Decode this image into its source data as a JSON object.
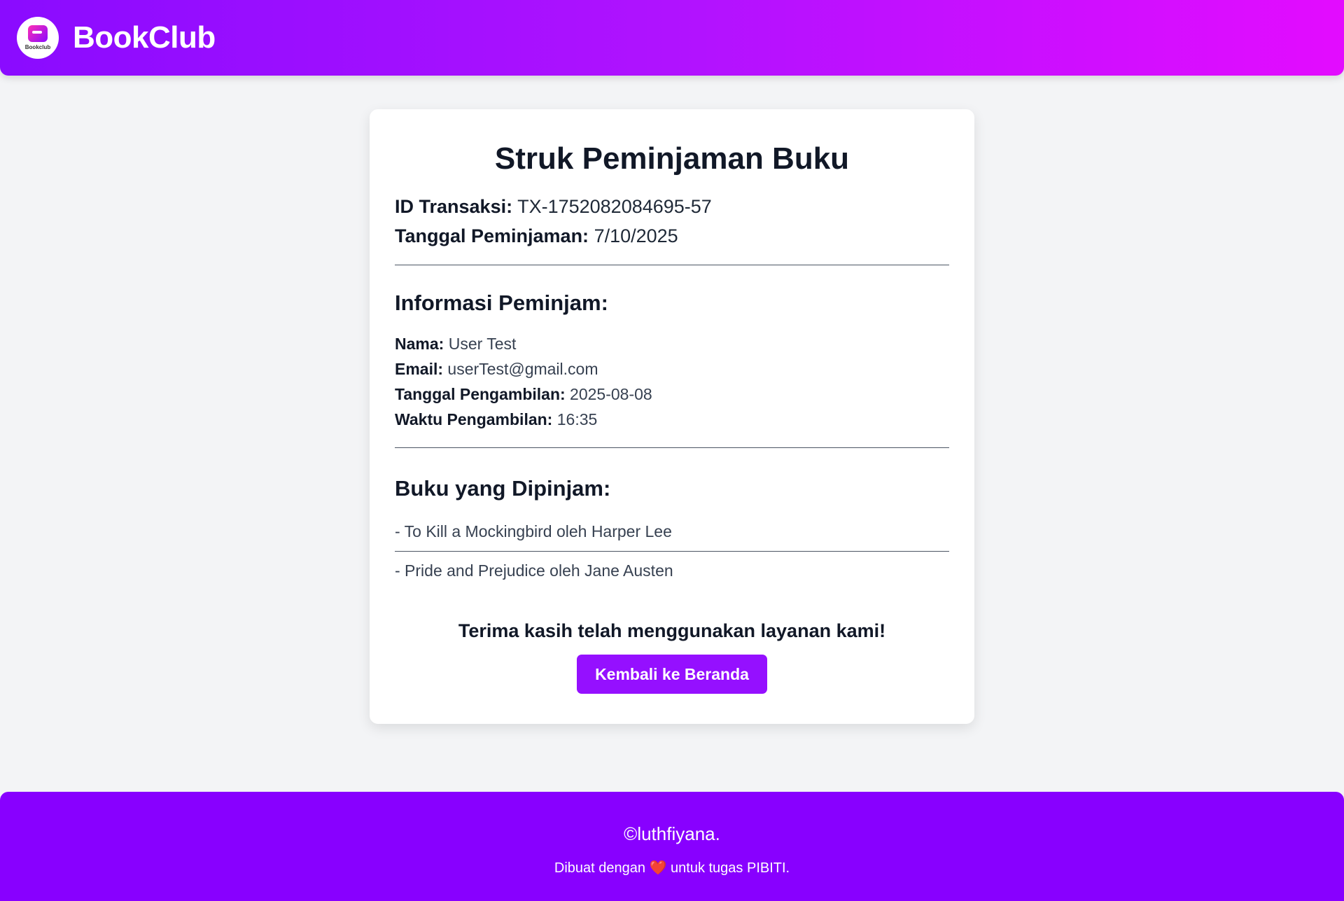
{
  "header": {
    "logo_text": "Bookclub",
    "brand": "BookClub"
  },
  "receipt": {
    "title": "Struk Peminjaman Buku",
    "transaction_id_label": "ID Transaksi:",
    "transaction_id": "TX-1752082084695-57",
    "loan_date_label": "Tanggal Peminjaman:",
    "loan_date": "7/10/2025",
    "borrower": {
      "heading": "Informasi Peminjam:",
      "name_label": "Nama:",
      "name": "User Test",
      "email_label": "Email:",
      "email": "userTest@gmail.com",
      "pickup_date_label": "Tanggal Pengambilan:",
      "pickup_date": "2025-08-08",
      "pickup_time_label": "Waktu Pengambilan:",
      "pickup_time": "16:35"
    },
    "books": {
      "heading": "Buku yang Dipinjam:",
      "items": [
        "- To Kill a Mockingbird oleh Harper Lee",
        "- Pride and Prejudice oleh Jane Austen"
      ]
    },
    "thanks": "Terima kasih telah menggunakan layanan kami!",
    "back_button": "Kembali ke Beranda"
  },
  "footer": {
    "copyright": "©luthfiyana.",
    "made_prefix": "Dibuat dengan",
    "heart": "❤️",
    "made_suffix": "untuk tugas PIBITI."
  },
  "colors": {
    "header_gradient_start": "#8a0bff",
    "header_gradient_end": "#e30cff",
    "button": "#9510ff",
    "footer": "#8800ff",
    "background": "#f3f4f6"
  }
}
